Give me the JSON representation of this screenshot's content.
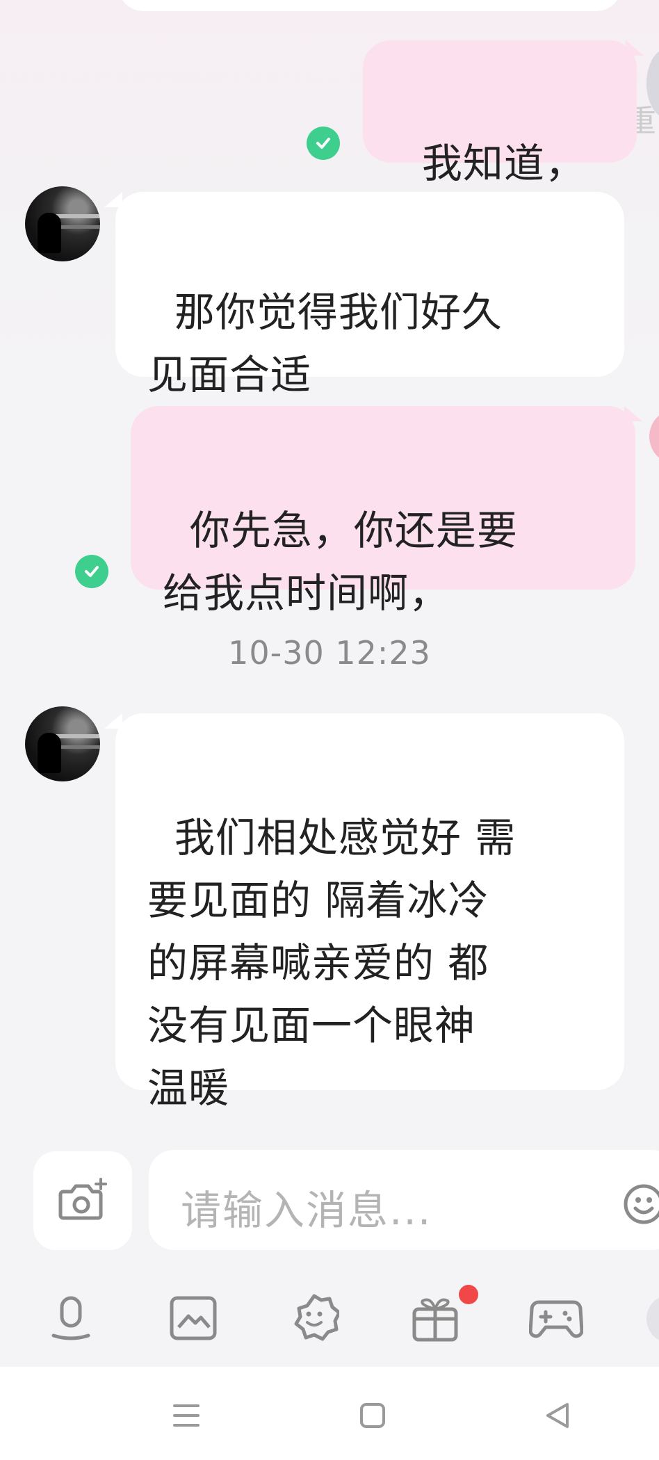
{
  "messages": [
    {
      "sender": "me",
      "text": "我知道，",
      "read": true
    },
    {
      "sender": "other",
      "text": "那你觉得我们好久\n见面合适"
    },
    {
      "sender": "me",
      "text": "你先急，你还是要\n给我点时间啊，",
      "read": true
    },
    {
      "sender": "other",
      "text": "我们相处感觉好 需\n要见面的 隔着冰冷\n的屏幕喊亲爱的 都\n没有见面一个眼神\n温暖"
    }
  ],
  "timestamp": "10-30 12:23",
  "edge_label": "重",
  "input": {
    "placeholder": "请输入消息..."
  },
  "toolbar": {
    "items": [
      "voice-icon",
      "image-icon",
      "sticker-icon",
      "gift-icon",
      "game-icon"
    ],
    "gift_badge": true
  },
  "navbar": {
    "items": [
      "menu-icon",
      "home-icon",
      "back-icon"
    ]
  },
  "colors": {
    "outgoing_bubble": "#fde0ee",
    "incoming_bubble": "#ffffff",
    "read_check": "#3ecf8e",
    "badge": "#f04848"
  }
}
